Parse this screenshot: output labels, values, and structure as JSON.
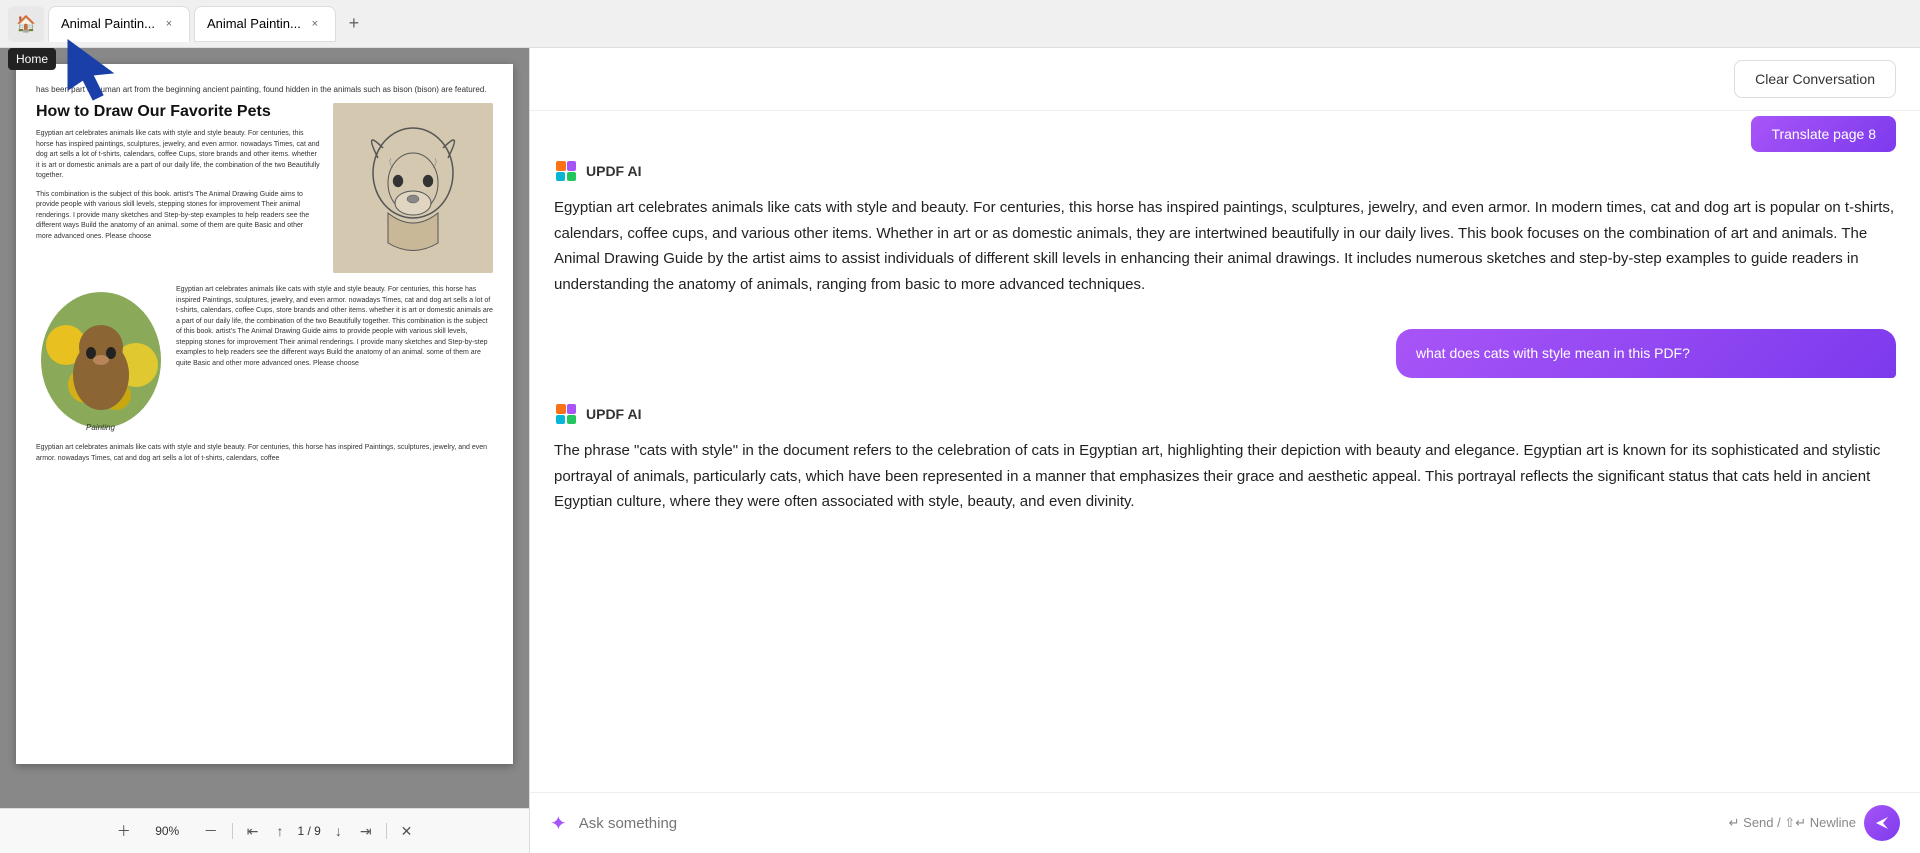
{
  "topbar": {
    "home_label": "Home",
    "home_tooltip": "Home",
    "tabs": [
      {
        "id": "tab1",
        "label": "Animal Paintin...",
        "active": true
      },
      {
        "id": "tab2",
        "label": "Animal Paintin...",
        "active": false
      }
    ],
    "add_tab_label": "+"
  },
  "pdf": {
    "intro_text": "has been part of human art from the beginning ancient painting, found hidden in the animals such as bison (bison) are featured.",
    "heading": "How to Draw Our Favorite Pets",
    "body_text1": "Egyptian art celebrates animals like cats with style and style beauty. For centuries, this horse has inspired paintings, sculptures, jewelry, and even armor. nowadays Times, cat and dog art sells a lot of t-shirts, calendars, coffee Cups, store brands and other items. whether it is art or domestic animals are a part of our daily life, the combination of the two Beautifully together.",
    "body_text2": "This combination is the subject of this book. artist's The Animal Drawing Guide aims to provide people with various skill levels, stepping stones for improvement Their animal renderings. I provide many sketches and Step-by-step examples to help readers see the different ways Build the anatomy of an animal. some of them are quite Basic and other more advanced ones. Please choose",
    "col_text": "Egyptian art celebrates animals like cats with style and style beauty. For centuries, this horse has inspired Paintings, sculptures, jewelry, and even armor. nowadays Times, cat and dog art sells a lot of t-shirts, calendars, coffee Cups, store brands and other items. whether it is art or domestic animals are a part of our daily life, the combination of the two Beautifully together.\n\nThis combination is the subject of this book. artist's The Animal Drawing Guide aims to provide people with various skill levels, stepping stones for improvement Their animal renderings. I provide many sketches and Step-by-step examples to help readers see the different ways Build the anatomy of an animal. some of them are quite Basic and other more advanced ones. Please choose",
    "col_text2": "Egyptian art celebrates animals like cats with style and style beauty. For centuries, this horse has inspired Paintings, sculptures, jewelry, and even armor. nowadays Times, cat and dog art sells a lot of t-shirts, calendars, coffee",
    "zoom": "90%",
    "page_current": "1",
    "page_total": "9"
  },
  "ai": {
    "clear_btn": "Clear Conversation",
    "translate_btn": "Translate page 8",
    "updf_label": "UPDF AI",
    "response1": "Egyptian art celebrates animals like cats with style and beauty. For centuries, this horse has inspired paintings, sculptures, jewelry, and even armor. In modern times, cat and dog art is popular on t-shirts, calendars, coffee cups, and various other items. Whether in art or as domestic animals, they are intertwined beautifully in our daily lives. This book focuses on the combination of art and animals. The Animal Drawing Guide by the artist aims to assist individuals of different skill levels in enhancing their animal drawings. It includes numerous sketches and step-by-step examples to guide readers in understanding the anatomy of animals, ranging from basic to more advanced techniques.",
    "user_message": "what does cats with style mean in this PDF?",
    "response2": "The phrase \"cats with style\" in the document refers to the celebration of cats in Egyptian art, highlighting their depiction with beauty and elegance. Egyptian art is known for its sophisticated and stylistic portrayal of animals, particularly cats, which have been represented in a manner that emphasizes their grace and aesthetic appeal. This portrayal reflects the significant status that cats held in ancient Egyptian culture, where they were often associated with style, beauty, and even divinity.",
    "input_placeholder": "Ask something",
    "send_label": "Send",
    "newline_label": "Newline",
    "send_shortcut": "↵ Send / ⇧↵ Newline"
  }
}
